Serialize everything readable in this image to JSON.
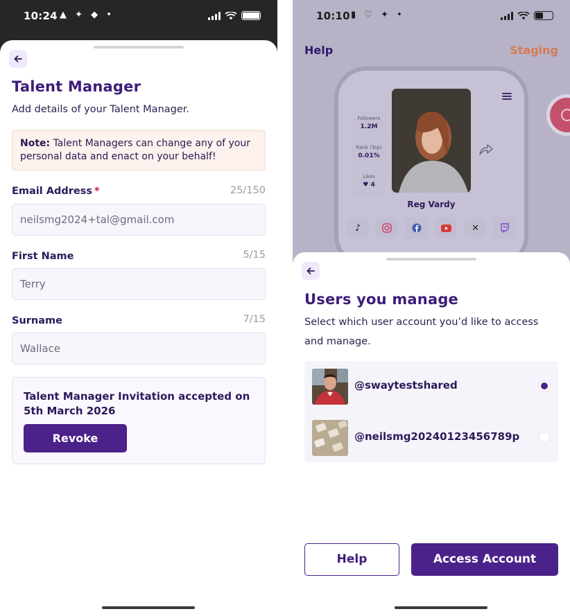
{
  "left_screen": {
    "status_time": "10:24",
    "title": "Talent Manager",
    "subtitle": "Add details of your Talent Manager.",
    "note_label": "Note:",
    "note_text": " Talent Managers can change any of your personal data and enact on your behalf!",
    "email": {
      "label": "Email Address",
      "required_mark": "*",
      "counter": "25/150",
      "value": "neilsmg2024+tal@gmail.com"
    },
    "first_name": {
      "label": "First Name",
      "counter": "5/15",
      "value": "Terry"
    },
    "surname": {
      "label": "Surname",
      "counter": "7/15",
      "value": "Wallace"
    },
    "invitation_text": "Talent Manager Invitation accepted on 5th March 2026",
    "revoke_label": "Revoke"
  },
  "right_screen": {
    "status_time": "10:10",
    "background": {
      "help_label": "Help",
      "staging_label": "Staging",
      "profile_name": "Reg Vardy",
      "stats": [
        {
          "label": "Followers",
          "value": "1.2M"
        },
        {
          "label": "Rank (Top)",
          "value": "0.01%"
        },
        {
          "label": "Likes",
          "value": "♥ 4"
        }
      ],
      "social_icons": [
        "tiktok-icon",
        "instagram-icon",
        "facebook-icon",
        "youtube-icon",
        "x-icon",
        "twitch-icon"
      ]
    },
    "sheet": {
      "title": "Users you manage",
      "subtitle": "Select which user account you’d like to access and manage.",
      "users": [
        {
          "handle": "@swaytestshared",
          "selected": true
        },
        {
          "handle": "@neilsmg20240123456789p",
          "selected": false
        }
      ],
      "help_button": "Help",
      "access_button": "Access Account"
    }
  },
  "colors": {
    "brand_purple": "#4a2289",
    "accent_orange": "#d77a55",
    "note_bg": "#fdf2ee",
    "required_red": "#c4213d"
  }
}
